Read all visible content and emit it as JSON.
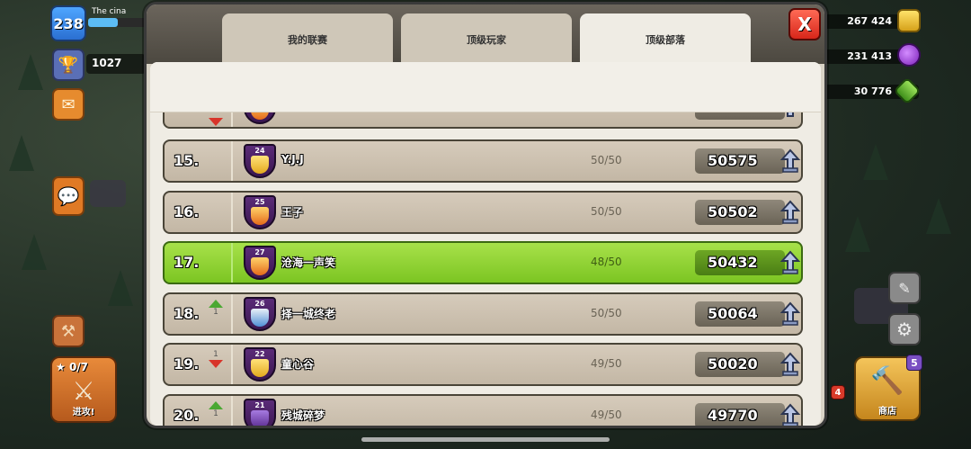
{
  "hud": {
    "level": "238",
    "player_name": "The cina",
    "trophies": "1027",
    "attack": {
      "stars": "0/7",
      "label": "进攻!"
    },
    "shop": {
      "label": "商店",
      "badge": "5"
    },
    "side_badge": "4"
  },
  "resources": {
    "gold": "267 424",
    "elixir": "231 413",
    "gems": "30 776"
  },
  "tabs": [
    {
      "label": "我的联赛"
    },
    {
      "label": "顶级玩家"
    },
    {
      "label": "顶级部落"
    }
  ],
  "active_tab": "顶级部落",
  "close_label": "X",
  "leaderboard": [
    {
      "rank": "15.",
      "trend": "",
      "trend_num": "",
      "level": "24",
      "name": "Y.J.J",
      "members": "50/50",
      "score": "50575",
      "emblem": "yellow"
    },
    {
      "rank": "16.",
      "trend": "",
      "trend_num": "",
      "level": "25",
      "name": "王子",
      "members": "50/50",
      "score": "50502",
      "emblem": "fire"
    },
    {
      "rank": "17.",
      "trend": "",
      "trend_num": "",
      "level": "27",
      "name": "沧海一声笑",
      "members": "48/50",
      "score": "50432",
      "emblem": "fire",
      "highlight": true
    },
    {
      "rank": "18.",
      "trend": "up",
      "trend_num": "1",
      "level": "26",
      "name": "择一城终老",
      "members": "50/50",
      "score": "50064",
      "emblem": "blue"
    },
    {
      "rank": "19.",
      "trend": "down",
      "trend_num": "1",
      "level": "22",
      "name": "童心谷",
      "members": "49/50",
      "score": "50020",
      "emblem": "yellow"
    },
    {
      "rank": "20.",
      "trend": "up",
      "trend_num": "1",
      "level": "21",
      "name": "残城碎梦",
      "members": "49/50",
      "score": "49770",
      "emblem": "purple"
    }
  ],
  "colors": {
    "highlight_row": "#8fd33a",
    "close_button": "#e0372a",
    "rank_up": "#4aa832",
    "rank_down": "#d8342a"
  }
}
